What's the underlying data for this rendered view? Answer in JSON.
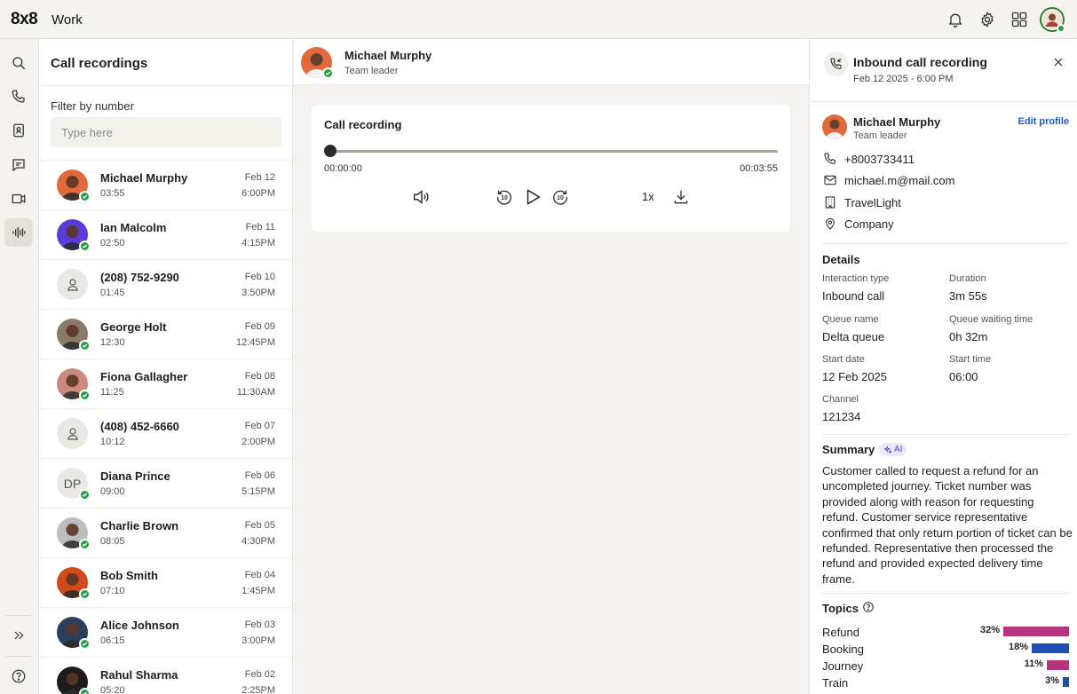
{
  "app": {
    "logo": "8x8",
    "title": "Work"
  },
  "list": {
    "title": "Call recordings",
    "filter_label": "Filter by number",
    "filter_placeholder": "Type here",
    "items": [
      {
        "name": "Michael Murphy",
        "duration": "03:55",
        "date": "Feb 12",
        "time": "6:00PM",
        "avatar": "photo",
        "color": "#e06a3b"
      },
      {
        "name": "Ian Malcolm",
        "duration": "02:50",
        "date": "Feb 11",
        "time": "4:15PM",
        "avatar": "photo",
        "color": "#5b3bd6"
      },
      {
        "name": "(208) 752-9290",
        "duration": "01:45",
        "date": "Feb 10",
        "time": "3:50PM",
        "avatar": "person"
      },
      {
        "name": "George Holt",
        "duration": "12:30",
        "date": "Feb 09",
        "time": "12:45PM",
        "avatar": "photo",
        "color": "#8a7a6a"
      },
      {
        "name": "Fiona Gallagher",
        "duration": "11:25",
        "date": "Feb 08",
        "time": "11:30AM",
        "avatar": "photo",
        "color": "#c98a80"
      },
      {
        "name": "(408) 452-6660",
        "duration": "10:12",
        "date": "Feb 07",
        "time": "2:00PM",
        "avatar": "person"
      },
      {
        "name": "Diana Prince",
        "duration": "09:00",
        "date": "Feb 06",
        "time": "5:15PM",
        "avatar": "initials",
        "initials": "DP"
      },
      {
        "name": "Charlie Brown",
        "duration": "08:05",
        "date": "Feb 05",
        "time": "4:30PM",
        "avatar": "photo",
        "color": "#bdbdbd"
      },
      {
        "name": "Bob Smith",
        "duration": "07:10",
        "date": "Feb 04",
        "time": "1:45PM",
        "avatar": "photo",
        "color": "#d14a1c"
      },
      {
        "name": "Alice Johnson",
        "duration": "06:15",
        "date": "Feb 03",
        "time": "3:00PM",
        "avatar": "photo",
        "color": "#2b3f5c"
      },
      {
        "name": "Rahul Sharma",
        "duration": "05:20",
        "date": "Feb 02",
        "time": "2:25PM",
        "avatar": "photo",
        "color": "#1c1c1c"
      }
    ]
  },
  "center": {
    "contact_name": "Michael Murphy",
    "contact_role": "Team leader",
    "player": {
      "title": "Call recording",
      "progress": 0,
      "time_start": "00:00:00",
      "time_end": "00:03:55",
      "speed": "1x"
    }
  },
  "details": {
    "title": "Inbound call recording",
    "subtitle": "Feb 12 2025 - 6:00 PM",
    "contact": {
      "name": "Michael Murphy",
      "role": "Team leader",
      "edit_label": "Edit profile",
      "phone": "+8003733411",
      "email": "michael.m@mail.com",
      "company_name": "TravelLight",
      "company_label": "Company"
    },
    "details_title": "Details",
    "fields": {
      "interaction_type_label": "Interaction type",
      "interaction_type": "Inbound call",
      "duration_label": "Duration",
      "duration": "3m 55s",
      "queue_name_label": "Queue name",
      "queue_name": "Delta queue",
      "queue_wait_label": "Queue waiting time",
      "queue_wait": "0h 32m",
      "start_date_label": "Start date",
      "start_date": "12 Feb 2025",
      "start_time_label": "Start time",
      "start_time": "06:00",
      "channel_label": "Channel",
      "channel": "121234"
    },
    "summary_title": "Summary",
    "ai_badge": "AI",
    "summary": "Customer called to request a refund for an uncompleted journey. Ticket number was provided along with reason for requesting refund. Customer service representative confirmed that only return portion of ticket can be refunded. Representative then processed the refund and provided expected delivery time frame.",
    "topics_title": "Topics",
    "topics": [
      {
        "label": "Refund",
        "pct": "32%",
        "value": 32,
        "color": "#b5357f"
      },
      {
        "label": "Booking",
        "pct": "18%",
        "value": 18,
        "color": "#1e4fb3"
      },
      {
        "label": "Journey",
        "pct": "11%",
        "value": 11,
        "color": "#b5357f"
      },
      {
        "label": "Train",
        "pct": "3%",
        "value": 3,
        "color": "#1e4fb3"
      }
    ]
  }
}
